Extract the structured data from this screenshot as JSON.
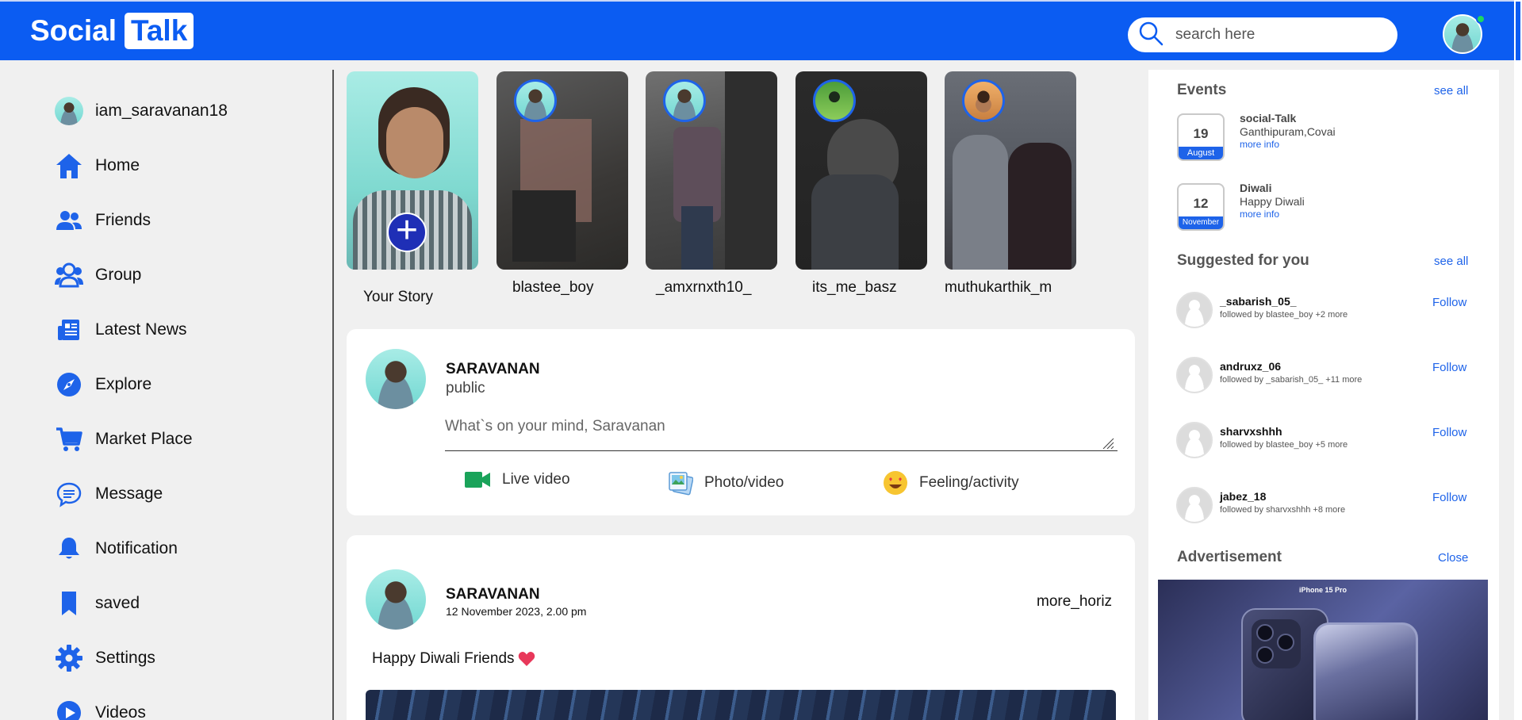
{
  "brand": {
    "name": "Social",
    "boxed": "Talk"
  },
  "search": {
    "placeholder": "search here"
  },
  "sidebar": {
    "user": "iam_saravanan18",
    "items": [
      {
        "label": "Home",
        "icon": "home-icon"
      },
      {
        "label": "Friends",
        "icon": "friends-icon"
      },
      {
        "label": "Group",
        "icon": "group-icon"
      },
      {
        "label": "Latest News",
        "icon": "news-icon"
      },
      {
        "label": "Explore",
        "icon": "compass-icon"
      },
      {
        "label": "Market Place",
        "icon": "cart-icon"
      },
      {
        "label": "Message",
        "icon": "message-icon"
      },
      {
        "label": "Notification",
        "icon": "bell-icon"
      },
      {
        "label": "saved",
        "icon": "bookmark-icon"
      },
      {
        "label": "Settings",
        "icon": "gear-icon"
      },
      {
        "label": "Videos",
        "icon": "play-icon"
      }
    ]
  },
  "stories": [
    {
      "label": "Your Story"
    },
    {
      "label": "blastee_boy"
    },
    {
      "label": "_amxrnxth10_"
    },
    {
      "label": "its_me_basz"
    },
    {
      "label": "muthukarthik_m"
    }
  ],
  "composer": {
    "name": "SARAVANAN",
    "visibility": "public",
    "placeholder": "What`s on your mind, Saravanan",
    "actions": [
      {
        "label": "Live video",
        "icon": "video-camera-icon"
      },
      {
        "label": "Photo/video",
        "icon": "photo-icon"
      },
      {
        "label": "Feeling/activity",
        "icon": "smiley-icon"
      }
    ]
  },
  "post": {
    "name": "SARAVANAN",
    "date": "12 November 2023, 2.00 pm",
    "menu": "more_horiz",
    "text": "Happy Diwali Friends"
  },
  "events": {
    "title": "Events",
    "see_all": "see all",
    "items": [
      {
        "day": "19",
        "month": "August",
        "title": "social-Talk",
        "sub": "Ganthipuram,Covai",
        "more": "more info"
      },
      {
        "day": "12",
        "month": "November",
        "title": "Diwali",
        "sub": "Happy Diwali",
        "more": "more info"
      }
    ]
  },
  "suggested": {
    "title": "Suggested for you",
    "see_all": "see all",
    "follow": "Follow",
    "items": [
      {
        "name": "_sabarish_05_",
        "sub": "followed by blastee_boy +2 more"
      },
      {
        "name": "andruxz_06",
        "sub": "followed by _sabarish_05_ +11 more"
      },
      {
        "name": "sharvxshhh",
        "sub": "followed by blastee_boy +5 more"
      },
      {
        "name": "jabez_18",
        "sub": "followed by sharvxshhh +8 more"
      }
    ]
  },
  "advertisement": {
    "title": "Advertisement",
    "close": "Close",
    "image_text": "iPhone 15 Pro"
  },
  "colors": {
    "primary": "#0b5cf2",
    "accent": "#1e63e9",
    "online": "#1ed760"
  }
}
